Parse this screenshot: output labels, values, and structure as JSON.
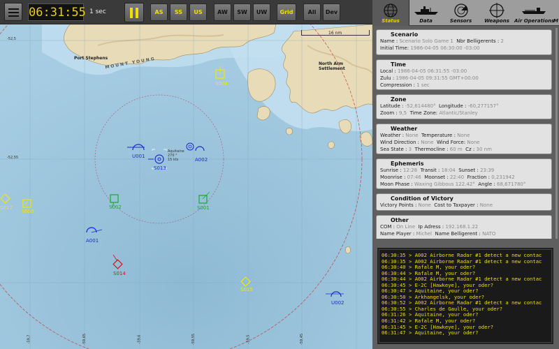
{
  "toolbar": {
    "clock": "06:31:55",
    "speed": "1 sec",
    "buttons": [
      "AS",
      "SS",
      "US",
      "AW",
      "SW",
      "UW",
      "Grid",
      "All",
      "Dev"
    ]
  },
  "map": {
    "scale_label": "16 nm",
    "places": [
      "Port Stephens",
      "MOUNT YOUNG",
      "North Arm Settlement"
    ],
    "units": [
      "S004",
      "U001",
      "S013",
      "A002",
      "S017",
      "S003",
      "S002",
      "S001",
      "A001",
      "S014",
      "S015",
      "U002"
    ],
    "selected_info": [
      "Aquitaine",
      "270 °",
      "15 kts"
    ],
    "coords": [
      "-52,5",
      "-52,55",
      "-59,7",
      "-59,65",
      "-59,6",
      "-59,55",
      "-59,5",
      "-59,45"
    ]
  },
  "colors": {
    "friendly": "#1a2ccc",
    "neutral": "#f0e800",
    "allied": "#13b024",
    "hostile": "#d01818",
    "console_text": "#f0dc10"
  },
  "tabs": [
    {
      "label": "Status",
      "icon": "globe-icon"
    },
    {
      "label": "Data",
      "icon": "ship-icon"
    },
    {
      "label": "Sensors",
      "icon": "radar-icon"
    },
    {
      "label": "Weapons",
      "icon": "crosshair-icon"
    },
    {
      "label": "Air Operations",
      "icon": "carrier-icon"
    },
    {
      "label": "M",
      "icon": ""
    }
  ],
  "status": {
    "scenario": {
      "title": "Scenario",
      "name_label": "Name :",
      "name_value": "Scenario Solo Game 1",
      "bellig_label": "Nbr Belligerents :",
      "bellig_value": "2",
      "initial_label": "Initial Time:",
      "initial_value": "1986-04-05  06:30:00  -03:00"
    },
    "time": {
      "title": "Time",
      "local_label": "Local :",
      "local_value": "1986-04-05  06:31:55  -03:00",
      "zulu_label": "Zulu :",
      "zulu_value": "1986-04-05  09:31:55  GMT+00:00",
      "comp_label": "Compression :",
      "comp_value": "1 sec"
    },
    "zone": {
      "title": "Zone",
      "lat_label": "Latitude :",
      "lat_value": "-52,614480°",
      "lon_label": "Longitude :",
      "lon_value": "-60,277157°",
      "zoom_label": "Zoom :",
      "zoom_value": "9,5",
      "tz_label": "Time Zone:",
      "tz_value": "Atlantic/Stanley"
    },
    "weather": {
      "title": "Weather",
      "weather_label": "Weather :",
      "weather_value": "None",
      "temp_label": "Temperature :",
      "temp_value": "None",
      "wdir_label": "Wind Direction :",
      "wdir_value": "None",
      "wforce_label": "Wind Force:",
      "wforce_value": "None",
      "sea_label": "Sea State :",
      "sea_value": "3",
      "thermo_label": "Thermocline :",
      "thermo_value": "60 m",
      "cz_label": "Cz :",
      "cz_value": "30 nm"
    },
    "ephemeris": {
      "title": "Ephemeris",
      "sunrise_label": "Sunrise :",
      "sunrise_value": "12:28",
      "transit_label": "Transit :",
      "transit_value": "18:04",
      "sunset_label": "Sunset :",
      "sunset_value": "23:39",
      "moonrise_label": "Moonrise :",
      "moonrise_value": "07:46",
      "moonset_label": "Moonset :",
      "moonset_value": "22:40",
      "fraction_label": "Fraction :",
      "fraction_value": "0,231942",
      "phase_label": "Moon Phase :",
      "phase_value": "Waxing Gibbous  122.42°",
      "angle_label": "Angle :",
      "angle_value": "68,671780°"
    },
    "victory": {
      "title": "Condition of Victory",
      "vp_label": "Victory Points :",
      "vp_value": "None",
      "cost_label": "Cost to Taxpayer :",
      "cost_value": "None"
    },
    "other": {
      "title": "Other",
      "com_label": "COM :",
      "com_value": "On Line",
      "ip_label": "Ip Adress :",
      "ip_value": "192.168.1.22",
      "player_label": "Name Player :",
      "player_value": "Michel",
      "nbell_label": "Name Belligerent :",
      "nbell_value": "NATO"
    }
  },
  "console": [
    "06:30:35 > A002 Airborne Radar #1 detect a new contac",
    "06:30:35 > A002 Airborne Radar #1 detect a new contac",
    "06:30:40 > Rafale M, your oder?",
    "06:30:44 > Rafale M, your oder?",
    "06:30:44 > A002 Airborne Radar #1 detect a new contac",
    "06:30:45 > E-2C [Hawkeye], your oder?",
    "06:30:47 > Aquitaine, your oder?",
    "06:30:50 > Arkhangelsk, your oder?",
    "06:30:52 > A002 Airborne Radar #1 detect a new contac",
    "06:30:55 > Charles de Gaulle, your oder?",
    "06:31:26 > Aquitaine, your oder?",
    "06:31:42 > Rafale M, your oder?",
    "06:31:45 > E-2C [Hawkeye], your oder?",
    "06:31:47 > Aquitaine, your oder?"
  ]
}
